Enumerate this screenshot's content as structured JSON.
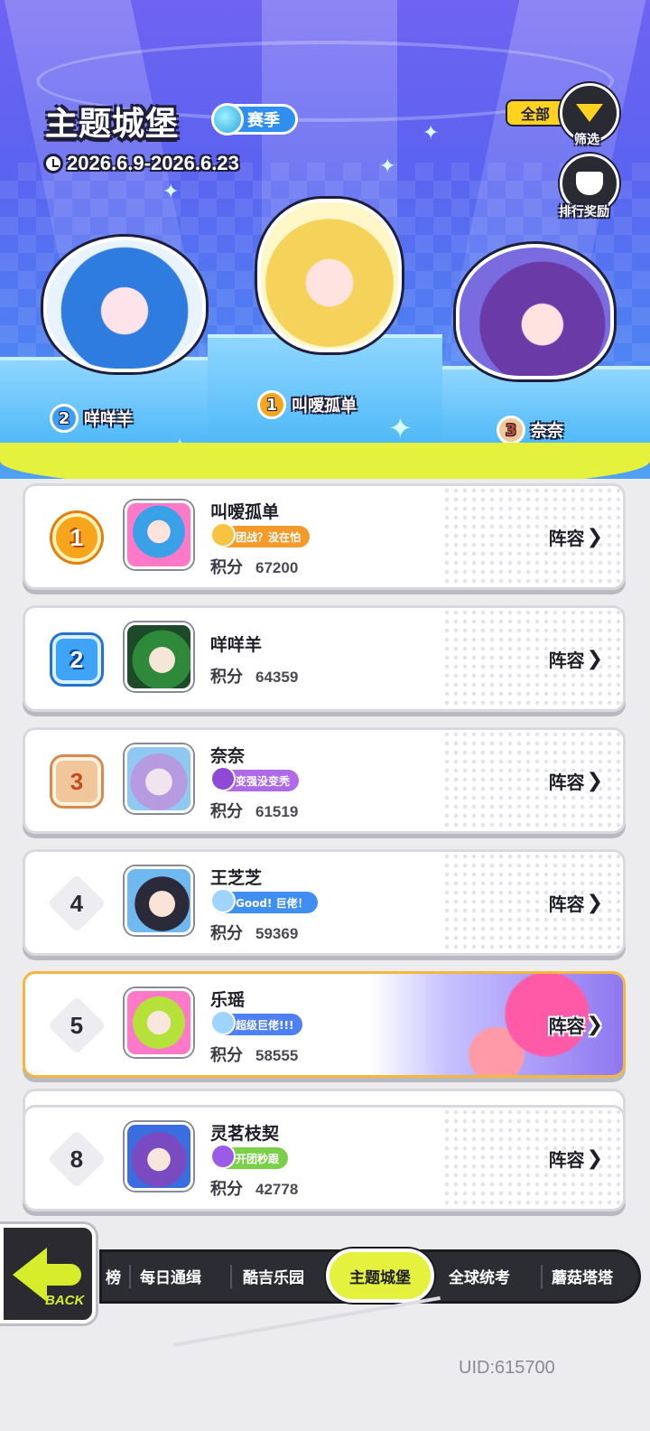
{
  "header": {
    "title": "主题城堡",
    "season_label": "赛季",
    "date_range": "2026.6.9-2026.6.23",
    "filter": {
      "scope_label": "全部",
      "button_label": "筛选"
    },
    "reward_label": "排行奖励"
  },
  "podium": [
    {
      "rank": "2",
      "name": "咩咩羊"
    },
    {
      "rank": "1",
      "name": "叫嗳孤单"
    },
    {
      "rank": "3",
      "name": "奈奈"
    }
  ],
  "leaderboard": [
    {
      "rank": "1",
      "name": "叫嗳孤单",
      "tag": "团战？没在怕",
      "score_label": "积分",
      "score": "67200",
      "lineup": "阵容",
      "tag_color": "#f39a2a"
    },
    {
      "rank": "2",
      "name": "咩咩羊",
      "tag": "",
      "score_label": "积分",
      "score": "64359",
      "lineup": "阵容",
      "tag_color": ""
    },
    {
      "rank": "3",
      "name": "奈奈",
      "tag": "变强没变秃",
      "score_label": "积分",
      "score": "61519",
      "lineup": "阵容",
      "tag_color": "#b06ae8"
    },
    {
      "rank": "4",
      "name": "王芝芝",
      "tag": "Good! 巨佬！",
      "score_label": "积分",
      "score": "59369",
      "lineup": "阵容",
      "tag_color": "#3f8ef2"
    },
    {
      "rank": "5",
      "name": "乐瑶",
      "tag": "超级巨佬!!!",
      "score_label": "积分",
      "score": "58555",
      "lineup": "阵容",
      "tag_color": "#4d7ff5"
    },
    {
      "rank": "8",
      "name": "灵茗枝契",
      "tag": "开团秒跟",
      "score_label": "积分",
      "score": "42778",
      "lineup": "阵容",
      "tag_color": "#7bd04a"
    }
  ],
  "nav": {
    "back_label": "BACK",
    "tabs": [
      {
        "label": "榜"
      },
      {
        "label": "每日通缉"
      },
      {
        "label": "酷吉乐园"
      },
      {
        "label": "主题城堡"
      },
      {
        "label": "全球统考"
      },
      {
        "label": "蘑菇塔塔"
      }
    ]
  },
  "footer": {
    "uid": "UID:615700"
  },
  "colors": {
    "accent_yellow": "#e5f23d",
    "banner_purple": "#6f63f2",
    "self_highlight": "#f4b63c"
  }
}
